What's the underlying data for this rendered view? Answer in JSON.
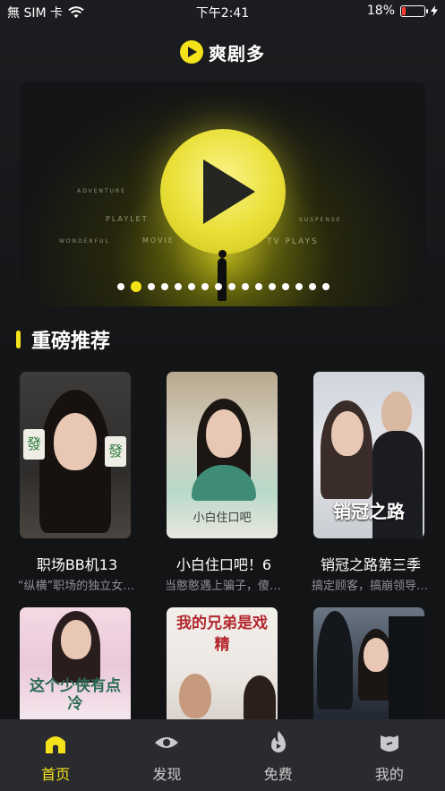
{
  "status_bar": {
    "carrier": "無 SIM 卡",
    "time": "下午2:41",
    "battery_percent": "18%",
    "battery_level": 0.18
  },
  "header": {
    "app_name": "爽剧多"
  },
  "banner": {
    "words": [
      "PLAYLET",
      "MOVIE",
      "TV PLAYS",
      "ADVENTURE",
      "SUSPENSE",
      "WONDERFUL"
    ],
    "page_count": 16,
    "active_index": 1
  },
  "section": {
    "title": "重磅推荐"
  },
  "cards": [
    {
      "title": "职场BB机13",
      "desc": "“纵横”职场的独立女…"
    },
    {
      "title": "小白住口吧！6",
      "desc": "当憨憨遇上骗子，傻…"
    },
    {
      "title": "销冠之路第三季",
      "desc": "搞定顾客，搞崩领导…"
    }
  ],
  "row2_posters": [
    {
      "text": "这个少侠有点冷"
    },
    {
      "text": "我的兄弟是戏精"
    },
    {
      "text": ""
    }
  ],
  "poster_texts": {
    "p1_tile": "發",
    "p2_caption": "小白住口吧",
    "p3_caption": "销冠之路"
  },
  "tabs": [
    {
      "label": "首页",
      "icon": "home-icon",
      "active": true
    },
    {
      "label": "发现",
      "icon": "eye-icon",
      "active": false
    },
    {
      "label": "免费",
      "icon": "flame-icon",
      "active": false
    },
    {
      "label": "我的",
      "icon": "profile-icon",
      "active": false
    }
  ],
  "colors": {
    "accent": "#f4e21b",
    "background": "#141517",
    "tabbar": "#2a2b2f",
    "muted_text": "#8f9095"
  }
}
